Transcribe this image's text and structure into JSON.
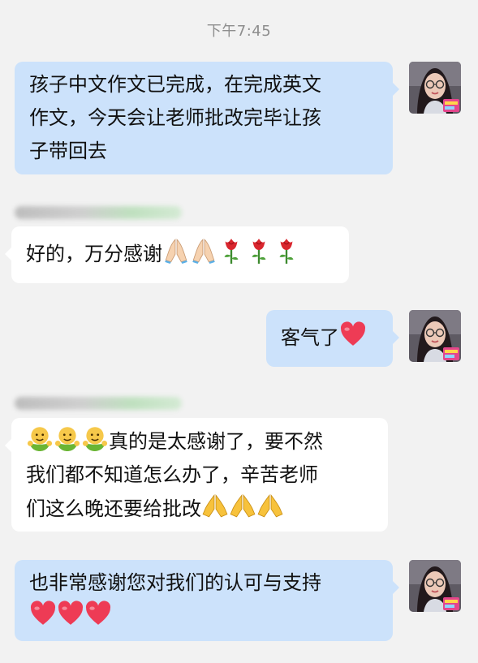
{
  "timestamp": "下午7:45",
  "messages": [
    {
      "dir": "out",
      "lines": [
        "孩子中文作文已完成，在完成英文",
        "作文，今天会让老师批改完毕让孩",
        "子带回去"
      ]
    },
    {
      "dir": "in",
      "text": "好的，万分感谢",
      "emoji": [
        "pray-icon",
        "pray-icon",
        "rose-icon",
        "rose-icon",
        "rose-icon"
      ]
    },
    {
      "dir": "out",
      "text": "客气了",
      "emoji": [
        "heart-icon"
      ]
    },
    {
      "dir": "in",
      "emoji": [
        "hug-icon",
        "hug-icon",
        "hug-icon"
      ],
      "lines": [
        "真的是太感谢了，要不然",
        "我们都不知道怎么办了，辛苦老师",
        "们这么晚还要给批改"
      ],
      "emoji_after": [
        "pray-icon",
        "pray-icon",
        "pray-icon"
      ]
    },
    {
      "dir": "out",
      "lines": [
        "也非常感谢您对我们的认可与支持"
      ],
      "emoji": [
        "heart-icon",
        "heart-icon",
        "heart-icon"
      ]
    }
  ],
  "colors": {
    "background": "#f2f2f2",
    "outgoing_bubble": "#cce2fb",
    "incoming_bubble": "#ffffff",
    "timestamp": "#8e8e8e",
    "heart": "#ee3b55",
    "rose": "#d9262e"
  }
}
